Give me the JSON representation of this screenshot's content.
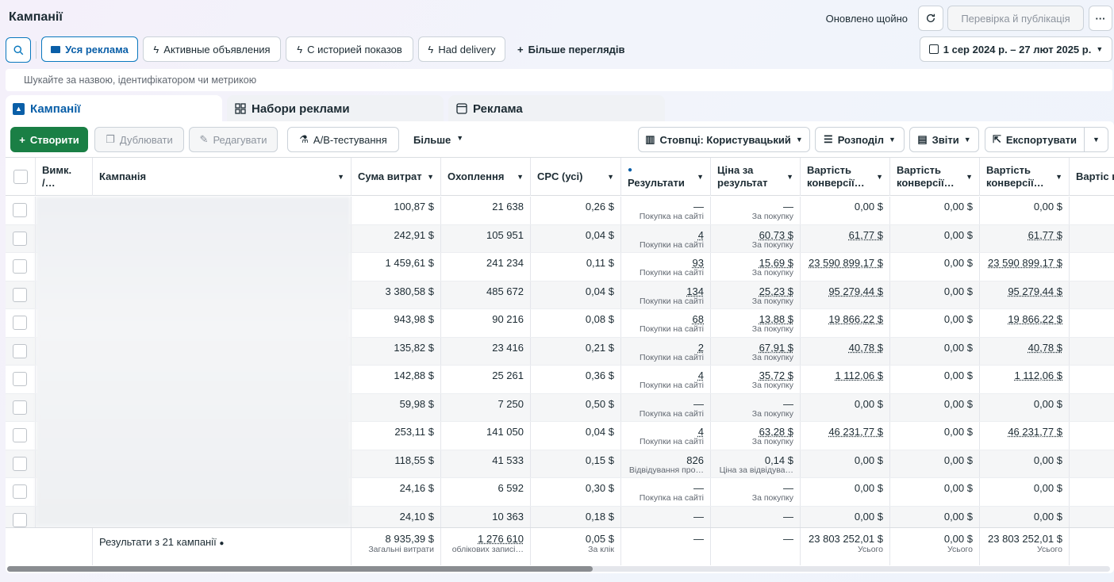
{
  "header": {
    "title": "Кампанії",
    "updated": "Оновлено щойно",
    "publish_label": "Перевірка й публікація",
    "more_label": "···"
  },
  "views": {
    "all": "Уся реклама",
    "active": "Активные объявления",
    "history": "С историей показов",
    "delivery": "Had delivery",
    "more": "Більше переглядів",
    "date_range": "1 сер 2024 р. – 27 лют 2025 р."
  },
  "search": {
    "placeholder": "Шукайте за назвою, ідентифікатором чи метрикою"
  },
  "tabs": {
    "campaigns": "Кампанії",
    "adsets": "Набори реклами",
    "ads": "Реклама"
  },
  "toolbar": {
    "create": "Створити",
    "duplicate": "Дублювати",
    "edit": "Редагувати",
    "ab_test": "A/B-тестування",
    "more": "Більше",
    "columns": "Стовпці: Користувацький",
    "breakdown": "Розподіл",
    "reports": "Звіти",
    "export": "Експортувати"
  },
  "columns": {
    "toggle": "Вимк. /…",
    "campaign": "Кампанія",
    "spend": "Сума витрат",
    "reach": "Охоплення",
    "cpc": "CPC (усі)",
    "results": "Результати",
    "cost_per_result": "Ціна за результат",
    "conv_value_1": "Вартість конверсії…",
    "conv_value_2": "Вартість конверсії…",
    "conv_value_3": "Вартість конверсії…",
    "conv_value_4": "Вартіс конвер"
  },
  "rows": [
    {
      "spend": "100,87 $",
      "reach": "21 638",
      "cpc": "0,26 $",
      "results": "—",
      "results_sub": "Покупка на сайті",
      "cpr": "—",
      "cpr_sub": "За покупку",
      "v1": "0,00 $",
      "v2": "0,00 $",
      "v3": "0,00 $",
      "und": false
    },
    {
      "spend": "242,91 $",
      "reach": "105 951",
      "cpc": "0,04 $",
      "results": "4",
      "results_sub": "Покупки на сайті",
      "cpr": "60,73 $",
      "cpr_sub": "За покупку",
      "v1": "61,77 $",
      "v2": "0,00 $",
      "v3": "61,77 $",
      "und": true
    },
    {
      "spend": "1 459,61 $",
      "reach": "241 234",
      "cpc": "0,11 $",
      "results": "93",
      "results_sub": "Покупки на сайті",
      "cpr": "15,69 $",
      "cpr_sub": "За покупку",
      "v1": "23 590 899,17 $",
      "v2": "0,00 $",
      "v3": "23 590 899,17 $",
      "und": true
    },
    {
      "spend": "3 380,58 $",
      "reach": "485 672",
      "cpc": "0,04 $",
      "results": "134",
      "results_sub": "Покупки на сайті",
      "cpr": "25,23 $",
      "cpr_sub": "За покупку",
      "v1": "95 279,44 $",
      "v2": "0,00 $",
      "v3": "95 279,44 $",
      "und": true
    },
    {
      "spend": "943,98 $",
      "reach": "90 216",
      "cpc": "0,08 $",
      "results": "68",
      "results_sub": "Покупки на сайті",
      "cpr": "13,88 $",
      "cpr_sub": "За покупку",
      "v1": "19 866,22 $",
      "v2": "0,00 $",
      "v3": "19 866,22 $",
      "und": true
    },
    {
      "spend": "135,82 $",
      "reach": "23 416",
      "cpc": "0,21 $",
      "results": "2",
      "results_sub": "Покупки на сайті",
      "cpr": "67,91 $",
      "cpr_sub": "За покупку",
      "v1": "40,78 $",
      "v2": "0,00 $",
      "v3": "40,78 $",
      "und": true
    },
    {
      "spend": "142,88 $",
      "reach": "25 261",
      "cpc": "0,36 $",
      "results": "4",
      "results_sub": "Покупки на сайті",
      "cpr": "35,72 $",
      "cpr_sub": "За покупку",
      "v1": "1 112,06 $",
      "v2": "0,00 $",
      "v3": "1 112,06 $",
      "und": true
    },
    {
      "spend": "59,98 $",
      "reach": "7 250",
      "cpc": "0,50 $",
      "results": "—",
      "results_sub": "Покупка на сайті",
      "cpr": "—",
      "cpr_sub": "За покупку",
      "v1": "0,00 $",
      "v2": "0,00 $",
      "v3": "0,00 $",
      "und": false
    },
    {
      "spend": "253,11 $",
      "reach": "141 050",
      "cpc": "0,04 $",
      "results": "4",
      "results_sub": "Покупки на сайті",
      "cpr": "63,28 $",
      "cpr_sub": "За покупку",
      "v1": "46 231,77 $",
      "v2": "0,00 $",
      "v3": "46 231,77 $",
      "und": true
    },
    {
      "spend": "118,55 $",
      "reach": "41 533",
      "cpc": "0,15 $",
      "results": "826",
      "results_sub": "Відвідування про…",
      "cpr": "0,14 $",
      "cpr_sub": "Ціна за відвідува…",
      "v1": "0,00 $",
      "v2": "0,00 $",
      "v3": "0,00 $",
      "und": false
    },
    {
      "spend": "24,16 $",
      "reach": "6 592",
      "cpc": "0,30 $",
      "results": "—",
      "results_sub": "Покупка на сайті",
      "cpr": "—",
      "cpr_sub": "За покупку",
      "v1": "0,00 $",
      "v2": "0,00 $",
      "v3": "0,00 $",
      "und": false
    },
    {
      "spend": "24,10 $",
      "reach": "10 363",
      "cpc": "0,18 $",
      "results": "—",
      "results_sub": "",
      "cpr": "—",
      "cpr_sub": "",
      "v1": "0,00 $",
      "v2": "0,00 $",
      "v3": "0,00 $",
      "und": false
    }
  ],
  "totals": {
    "label": "Результати з 21 кампанії",
    "spend": "8 935,39 $",
    "spend_sub": "Загальні витрати",
    "reach": "1 276 610",
    "reach_sub": "облікових записі…",
    "cpc": "0,05 $",
    "cpc_sub": "За клік",
    "results": "—",
    "cpr": "—",
    "v1": "23 803 252,01 $",
    "v1_sub": "Усього",
    "v2": "0,00 $",
    "v2_sub": "Усього",
    "v3": "23 803 252,01 $",
    "v3_sub": "Усього"
  },
  "colors": {
    "accent": "#0a5fa8",
    "create": "#1a7f45"
  }
}
